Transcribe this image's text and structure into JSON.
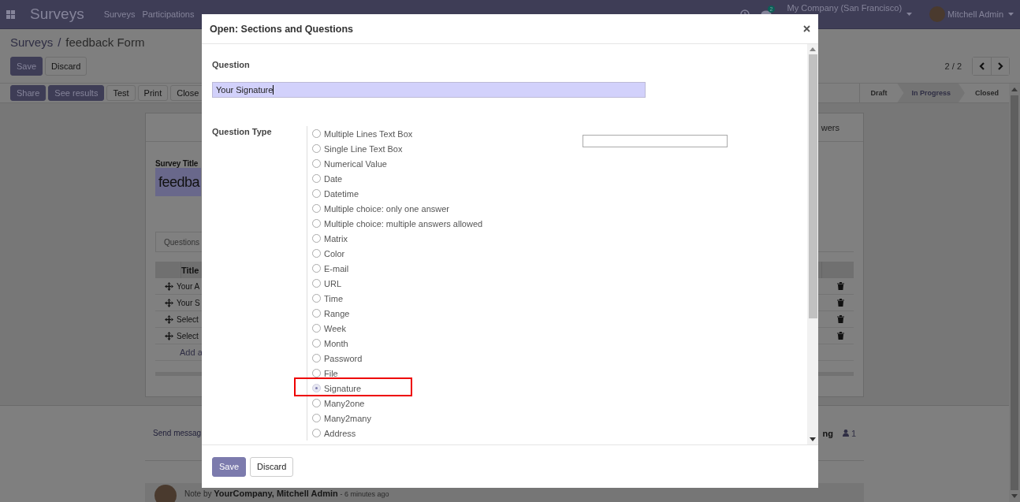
{
  "navbar": {
    "app_name": "Surveys",
    "menu": [
      {
        "label": "Surveys"
      },
      {
        "label": "Participations"
      }
    ],
    "messages_badge": "2",
    "company": "My Company (San Francisco)",
    "user": "Mitchell Admin"
  },
  "breadcrumb": {
    "parent": "Surveys",
    "separator": "/",
    "current": "feedback Form"
  },
  "form_buttons": [
    {
      "label": "Save",
      "kind": "primary"
    },
    {
      "label": "Discard",
      "kind": "secondary"
    }
  ],
  "pager": "2 / 2",
  "action_buttons": [
    {
      "label": "Share",
      "kind": "primary"
    },
    {
      "label": "See results",
      "kind": "primary"
    },
    {
      "label": "Test",
      "kind": "secondary"
    },
    {
      "label": "Print",
      "kind": "secondary"
    },
    {
      "label": "Close",
      "kind": "secondary"
    }
  ],
  "stages": [
    {
      "label": "Draft",
      "selected": false
    },
    {
      "label": "In Progress",
      "selected": true
    },
    {
      "label": "Closed",
      "selected": false
    }
  ],
  "sheet": {
    "tab_fragment": "wers",
    "title_label": "Survey Title",
    "title_value": "feedba",
    "notebook_tab": "Questions",
    "table": {
      "columns": [
        "Title"
      ],
      "rows": [
        "Your A",
        "Your S",
        "Select",
        "Select"
      ],
      "add_link": "Add a"
    }
  },
  "chatter": {
    "send_message": "Send messag",
    "activity_fragment": "ng",
    "followers": "1",
    "message": {
      "prefix": "Note by",
      "author": "YourCompany, Mitchell Admin",
      "time": "- 6 minutes ago"
    }
  },
  "dialog": {
    "title": "Open: Sections and Questions",
    "question_label": "Question",
    "question_value": "Your Signature",
    "type_label": "Question Type",
    "types": [
      {
        "label": "Multiple Lines Text Box",
        "selected": false
      },
      {
        "label": "Single Line Text Box",
        "selected": false
      },
      {
        "label": "Numerical Value",
        "selected": false
      },
      {
        "label": "Date",
        "selected": false
      },
      {
        "label": "Datetime",
        "selected": false
      },
      {
        "label": "Multiple choice: only one answer",
        "selected": false
      },
      {
        "label": "Multiple choice: multiple answers allowed",
        "selected": false
      },
      {
        "label": "Matrix",
        "selected": false
      },
      {
        "label": "Color",
        "selected": false
      },
      {
        "label": "E-mail",
        "selected": false
      },
      {
        "label": "URL",
        "selected": false
      },
      {
        "label": "Time",
        "selected": false
      },
      {
        "label": "Range",
        "selected": false
      },
      {
        "label": "Week",
        "selected": false
      },
      {
        "label": "Month",
        "selected": false
      },
      {
        "label": "Password",
        "selected": false
      },
      {
        "label": "File",
        "selected": false
      },
      {
        "label": "Signature",
        "selected": true
      },
      {
        "label": "Many2one",
        "selected": false
      },
      {
        "label": "Many2many",
        "selected": false
      },
      {
        "label": "Address",
        "selected": false
      }
    ],
    "buttons": [
      {
        "label": "Save",
        "kind": "primary"
      },
      {
        "label": "Discard",
        "kind": "secondary"
      }
    ]
  }
}
